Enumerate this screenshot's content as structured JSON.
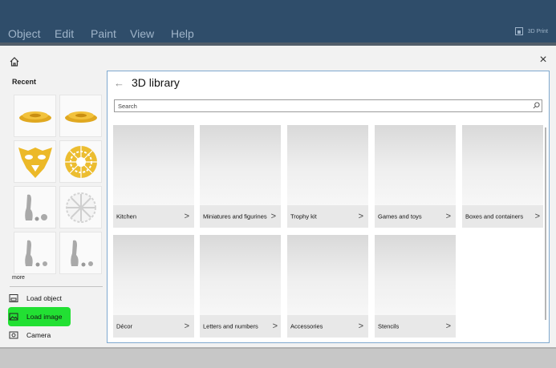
{
  "menu": {
    "items": [
      "Object",
      "Edit",
      "Paint",
      "View",
      "Help"
    ],
    "brand_label": "3D Print"
  },
  "sidebar": {
    "recent_label": "Recent",
    "more_label": "more",
    "load_object_label": "Load object",
    "load_image_label": "Load image",
    "camera_label": "Camera"
  },
  "library": {
    "title": "3D library",
    "search_placeholder": "Search",
    "categories": [
      "Kitchen",
      "Miniatures and figurines",
      "Trophy kit",
      "Games and toys",
      "Boxes and containers",
      "Décor",
      "Letters and numbers",
      "Accessories",
      "Stencils"
    ]
  },
  "colors": {
    "menubar": "#2f4d6a",
    "highlight": "#22e033",
    "thumb_gold": "#e8b82c",
    "dialog_border": "#7fa9cf"
  },
  "icons": {
    "home": "home-icon",
    "close": "close-icon",
    "back": "back-arrow-icon",
    "search": "search-icon",
    "chevron": "chevron-right-icon",
    "load_object": "load-object-icon",
    "load_image": "load-image-icon",
    "camera": "camera-icon"
  }
}
